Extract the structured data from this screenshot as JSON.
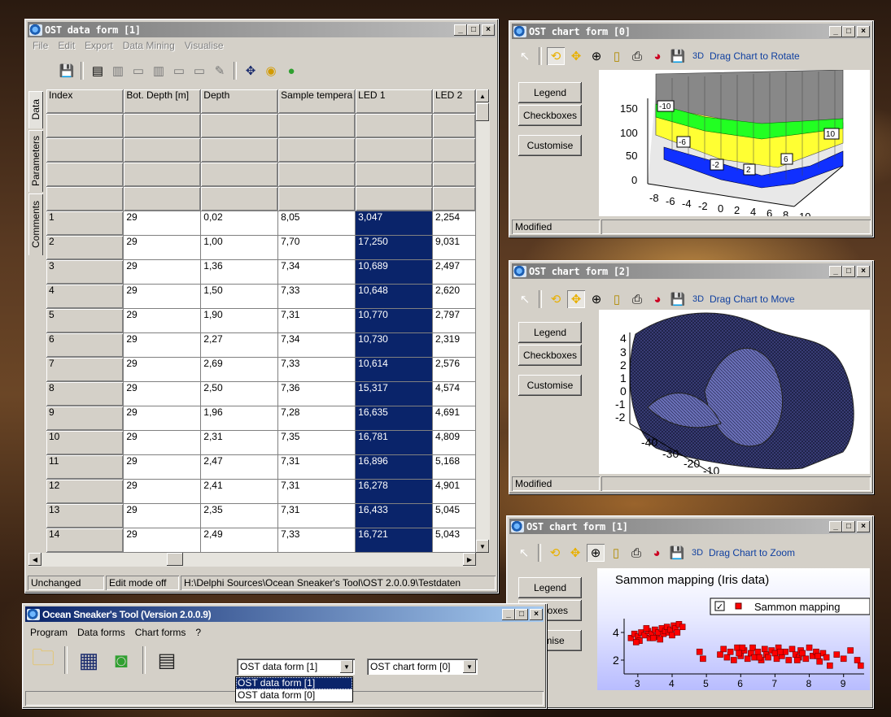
{
  "data_form": {
    "title": "OST data form [1]",
    "menu": [
      "File",
      "Edit",
      "Export",
      "Data Mining",
      "Visualise"
    ],
    "side_tabs": [
      "Data",
      "Parameters",
      "Comments"
    ],
    "columns": [
      "Index",
      "Bot. Depth [m]",
      "Depth",
      "Sample tempera",
      "LED 1",
      "LED 2"
    ],
    "rows": [
      [
        "1",
        "29",
        "0,02",
        "8,05",
        "3,047",
        "2,254"
      ],
      [
        "2",
        "29",
        "1,00",
        "7,70",
        "17,250",
        "9,031"
      ],
      [
        "3",
        "29",
        "1,36",
        "7,34",
        "10,689",
        "2,497"
      ],
      [
        "4",
        "29",
        "1,50",
        "7,33",
        "10,648",
        "2,620"
      ],
      [
        "5",
        "29",
        "1,90",
        "7,31",
        "10,770",
        "2,797"
      ],
      [
        "6",
        "29",
        "2,27",
        "7,34",
        "10,730",
        "2,319"
      ],
      [
        "7",
        "29",
        "2,69",
        "7,33",
        "10,614",
        "2,576"
      ],
      [
        "8",
        "29",
        "2,50",
        "7,36",
        "15,317",
        "4,574"
      ],
      [
        "9",
        "29",
        "1,96",
        "7,28",
        "16,635",
        "4,691"
      ],
      [
        "10",
        "29",
        "2,31",
        "7,35",
        "16,781",
        "4,809"
      ],
      [
        "11",
        "29",
        "2,47",
        "7,31",
        "16,896",
        "5,168"
      ],
      [
        "12",
        "29",
        "2,41",
        "7,31",
        "16,278",
        "4,901"
      ],
      [
        "13",
        "29",
        "2,35",
        "7,31",
        "16,433",
        "5,045"
      ],
      [
        "14",
        "29",
        "2,49",
        "7,33",
        "16,721",
        "5,043"
      ]
    ],
    "status": [
      "Unchanged",
      "Edit mode off",
      "H:\\Delphi Sources\\Ocean Sneaker's Tool\\OST 2.0.0.9\\Testdaten"
    ]
  },
  "chart0": {
    "title": "OST chart form [0]",
    "mode_label": "Drag Chart to Rotate",
    "threed": "3D",
    "buttons": [
      "Legend",
      "Checkboxes",
      "Customise"
    ],
    "status": "Modified",
    "yticks": [
      "150",
      "100",
      "50",
      "0"
    ],
    "xticks": [
      "-8",
      "-6",
      "-4",
      "-2",
      "0",
      "2",
      "4",
      "6",
      "8",
      "10"
    ],
    "marks": [
      "-10",
      "-6",
      "-2",
      "2",
      "6",
      "10"
    ]
  },
  "chart2": {
    "title": "OST chart form [2]",
    "mode_label": "Drag Chart to Move",
    "threed": "3D",
    "buttons": [
      "Legend",
      "Checkboxes",
      "Customise"
    ],
    "status": "Modified",
    "yticks": [
      "4",
      "3",
      "2",
      "1",
      "0",
      "-1",
      "-2"
    ],
    "xticks": [
      "-40",
      "-30",
      "-20",
      "-10"
    ]
  },
  "chart1": {
    "title": "OST chart form [1]",
    "mode_label": "Drag Chart to Zoom",
    "threed": "3D",
    "buttons": [
      "Legend",
      "ckboxes",
      "tomise"
    ]
  },
  "main": {
    "title": "Ocean Sneaker's Tool  (Version 2.0.0.9)",
    "menu": [
      "Program",
      "Data forms",
      "Chart forms",
      "?"
    ],
    "data_combo": "OST data form [1]",
    "chart_combo": "OST chart form [0]",
    "dropdown": [
      "OST data form [1]",
      "OST data form [0]"
    ]
  },
  "chart_data": {
    "type": "scatter",
    "title": "Sammon mapping (Iris data)",
    "xlabel": "",
    "ylabel": "",
    "xlim": [
      2.6,
      9.6
    ],
    "ylim": [
      1,
      5
    ],
    "xticks": [
      3,
      4,
      5,
      6,
      7,
      8,
      9
    ],
    "yticks": [
      2,
      4
    ],
    "legend": "top-right",
    "grid": false,
    "series": [
      {
        "name": "Sammon mapping",
        "color": "#ff0000",
        "points": [
          [
            2.8,
            3.6
          ],
          [
            2.9,
            3.9
          ],
          [
            3.0,
            3.7
          ],
          [
            3.05,
            3.4
          ],
          [
            3.1,
            4.0
          ],
          [
            3.2,
            3.8
          ],
          [
            3.3,
            4.1
          ],
          [
            3.35,
            3.6
          ],
          [
            3.4,
            3.9
          ],
          [
            3.5,
            4.2
          ],
          [
            3.55,
            3.7
          ],
          [
            3.6,
            4.0
          ],
          [
            3.7,
            4.3
          ],
          [
            3.75,
            3.9
          ],
          [
            3.8,
            4.1
          ],
          [
            3.85,
            4.4
          ],
          [
            3.9,
            4.0
          ],
          [
            3.95,
            4.2
          ],
          [
            4.0,
            3.8
          ],
          [
            4.05,
            4.5
          ],
          [
            4.1,
            4.3
          ],
          [
            4.2,
            4.6
          ],
          [
            4.3,
            4.4
          ],
          [
            2.95,
            3.3
          ],
          [
            3.25,
            4.3
          ],
          [
            3.65,
            3.5
          ],
          [
            4.15,
            4.0
          ],
          [
            3.45,
            3.6
          ],
          [
            4.8,
            2.6
          ],
          [
            4.9,
            2.1
          ],
          [
            5.4,
            2.4
          ],
          [
            5.5,
            2.8
          ],
          [
            5.6,
            2.2
          ],
          [
            5.7,
            2.6
          ],
          [
            5.8,
            2.0
          ],
          [
            5.9,
            2.9
          ],
          [
            6.0,
            2.3
          ],
          [
            6.1,
            2.7
          ],
          [
            6.2,
            2.1
          ],
          [
            6.3,
            2.5
          ],
          [
            6.35,
            2.9
          ],
          [
            6.4,
            2.2
          ],
          [
            6.5,
            2.6
          ],
          [
            6.6,
            2.0
          ],
          [
            6.7,
            2.8
          ],
          [
            6.75,
            2.4
          ],
          [
            6.8,
            2.2
          ],
          [
            6.9,
            2.7
          ],
          [
            7.0,
            2.5
          ],
          [
            7.05,
            2.1
          ],
          [
            7.1,
            2.9
          ],
          [
            7.2,
            2.3
          ],
          [
            7.3,
            2.6
          ],
          [
            7.4,
            2.0
          ],
          [
            7.5,
            2.8
          ],
          [
            7.6,
            2.4
          ],
          [
            7.7,
            2.2
          ],
          [
            7.75,
            2.7
          ],
          [
            7.8,
            2.5
          ],
          [
            7.9,
            2.1
          ],
          [
            8.0,
            2.9
          ],
          [
            8.1,
            2.3
          ],
          [
            8.2,
            2.6
          ],
          [
            8.3,
            1.9
          ],
          [
            8.4,
            2.5
          ],
          [
            8.5,
            2.2
          ],
          [
            8.6,
            1.6
          ],
          [
            8.8,
            2.4
          ],
          [
            9.0,
            2.1
          ],
          [
            9.2,
            2.7
          ],
          [
            9.4,
            2.0
          ],
          [
            9.5,
            1.6
          ],
          [
            6.05,
            2.9
          ],
          [
            6.55,
            2.2
          ],
          [
            7.15,
            2.6
          ],
          [
            7.65,
            2.0
          ],
          [
            8.25,
            2.3
          ],
          [
            5.95,
            2.5
          ]
        ]
      }
    ]
  }
}
